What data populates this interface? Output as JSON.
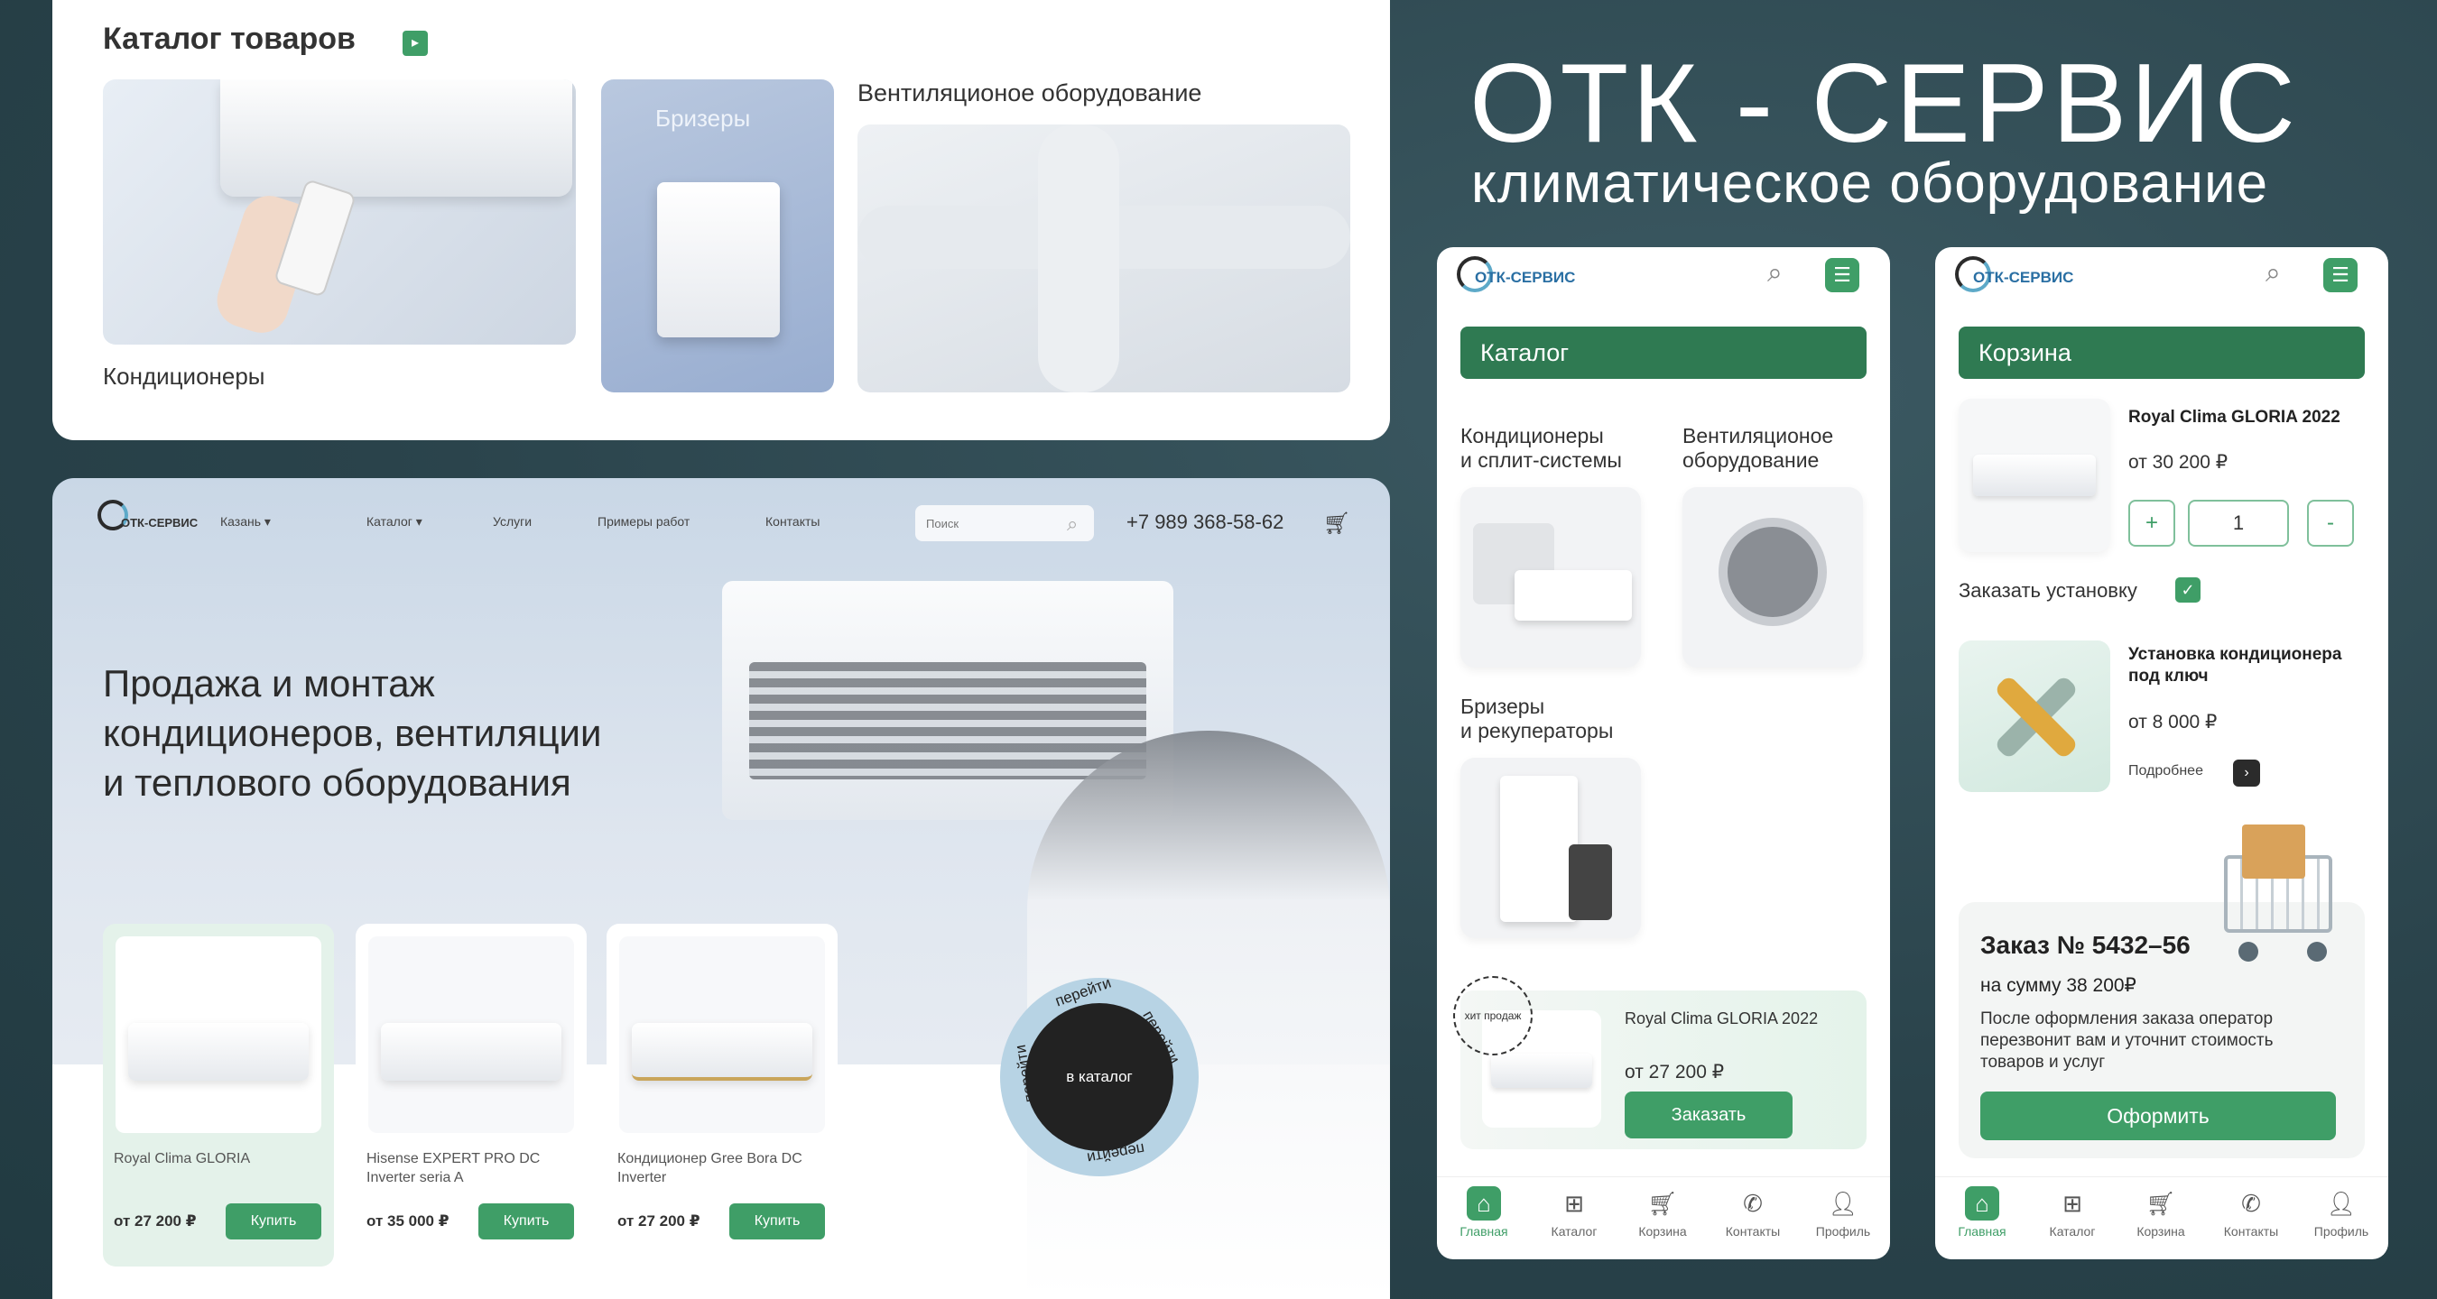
{
  "brand": {
    "title": "ОТК - СЕРВИС",
    "subtitle": "климатическое оборудование"
  },
  "catalog_card": {
    "title": "Каталог товаров",
    "title_icon": "▸",
    "categories": [
      {
        "label": "Кондиционеры"
      },
      {
        "label": "Бризеры"
      },
      {
        "label": "Вентиляционое оборудование"
      }
    ]
  },
  "landing": {
    "logo": "ОТК-СЕРВИС",
    "nav": {
      "city": "Казань ▾",
      "catalog": "Каталог ▾",
      "services": "Услуги",
      "works": "Примеры работ",
      "contacts": "Контакты"
    },
    "search_placeholder": "Поиск",
    "phone": "+7 989 368-58-62",
    "cart_icon": "cart-icon",
    "headline_lines": [
      "Продажа и монтаж",
      "кондиционеров, вентиляции",
      "и теплового оборудования"
    ],
    "products": [
      {
        "name": "Royal Clima GLORIA",
        "price": "от 27 200 ₽",
        "buy": "Купить"
      },
      {
        "name": "Hisense EXPERT PRO DC Inverter seria A",
        "price": "от 35 000 ₽",
        "buy": "Купить"
      },
      {
        "name": "Кондиционер Gree Bora DC Inverter",
        "price": "от 27 200 ₽",
        "buy": "Купить"
      }
    ],
    "badge": {
      "center": "в каталог",
      "ring_top": "перейти",
      "ring_right": "перейти",
      "ring_bottom": "перейти",
      "ring_left": "перейти"
    }
  },
  "phone_catalog": {
    "logo": "ОТК-СЕРВИС",
    "header": "Каталог",
    "categories": [
      {
        "label_line1": "Кондиционеры",
        "label_line2": "и сплит-системы"
      },
      {
        "label_line1": "Вентиляционое",
        "label_line2": "оборудование"
      },
      {
        "label_line1": "Бризеры",
        "label_line2": "и рекуператоры"
      }
    ],
    "promo": {
      "badge": "хит продаж",
      "name": "Royal Clima GLORIA 2022",
      "price": "от 27 200 ₽",
      "order": "Заказать"
    }
  },
  "phone_cart": {
    "logo": "ОТК-СЕРВИС",
    "header": "Корзина",
    "item": {
      "name": "Royal Clima GLORIA 2022",
      "price": "от 30 200 ₽",
      "qty": "1",
      "plus": "+",
      "minus": "-"
    },
    "install": {
      "label": "Заказать установку",
      "checked": true
    },
    "service": {
      "name": "Установка кондиционера под ключ",
      "price": "от 8 000 ₽",
      "more": "Подробнее"
    },
    "order": {
      "number": "Заказ № 5432–56",
      "sum": "на сумму 38 200₽",
      "note": "После оформления заказа оператор перезвонит вам и уточнит стоимость товаров и услуг",
      "checkout": "Оформить"
    }
  },
  "bottom_nav": [
    "Главная",
    "Каталог",
    "Корзина",
    "Контакты",
    "Профиль"
  ],
  "colors": {
    "accent": "#3f9e67",
    "dark_green": "#2f7a52",
    "background": "#2a434b"
  }
}
